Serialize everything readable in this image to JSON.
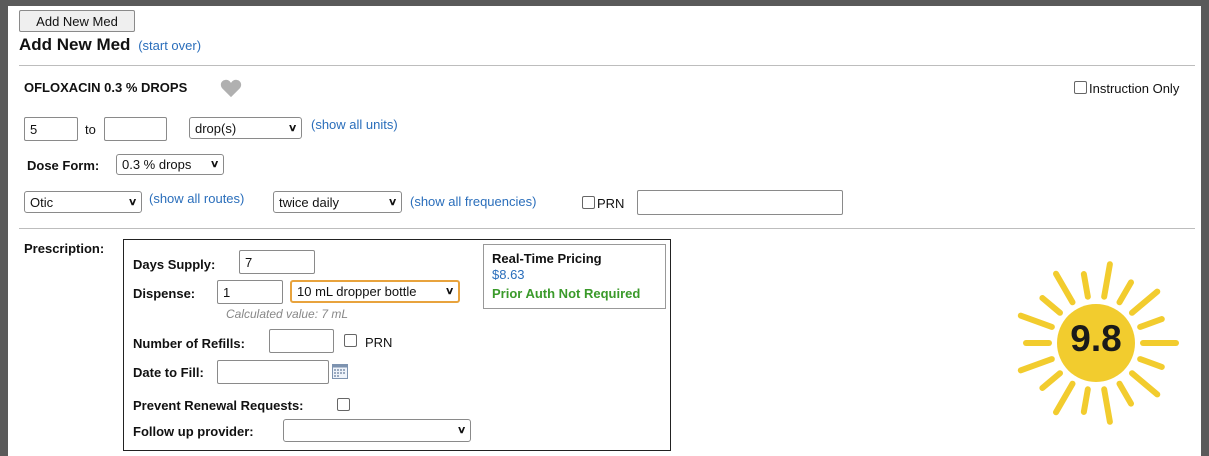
{
  "header": {
    "add_button_label": "Add New Med",
    "title": "Add New Med",
    "start_over_link": "(start over)"
  },
  "med": {
    "name": "OFLOXACIN 0.3 % DROPS",
    "favorite_icon": "heart-icon",
    "instruction_only_label": "Instruction Only"
  },
  "dose": {
    "from_value": "5",
    "to_label": "to",
    "to_value": "",
    "unit_selected": "drop(s)",
    "show_units_link": "(show all units)"
  },
  "dose_form": {
    "label": "Dose Form:",
    "selected": "0.3 % drops"
  },
  "route": {
    "selected": "Otic",
    "show_routes_link": "(show all routes)",
    "frequency_selected": "twice daily",
    "show_frequencies_link": "(show all frequencies)",
    "prn_label": "PRN",
    "prn_value": ""
  },
  "prescription": {
    "section_label": "Prescription:",
    "days_supply_label": "Days Supply:",
    "days_supply_value": "7",
    "dispense_label": "Dispense:",
    "dispense_value": "1",
    "dispense_unit_selected": "10 mL dropper bottle",
    "calculated_value": "Calculated value: 7 mL",
    "refills_label": "Number of Refills:",
    "refills_value": "",
    "refills_prn_label": "PRN",
    "date_to_fill_label": "Date to Fill:",
    "date_to_fill_value": "",
    "calendar_icon": "calendar-icon",
    "prevent_renewal_label": "Prevent Renewal Requests:",
    "follow_up_label": "Follow up provider:",
    "follow_up_selected": ""
  },
  "pricing": {
    "title": "Real-Time Pricing",
    "price": "$8.63",
    "auth_status": "Prior Auth Not Required",
    "price_color": "#2a6ebb",
    "auth_color": "#3a9a2a"
  },
  "score_badge": {
    "value": "9.8",
    "icon": "sun-icon",
    "color": "#f2cc2e"
  }
}
